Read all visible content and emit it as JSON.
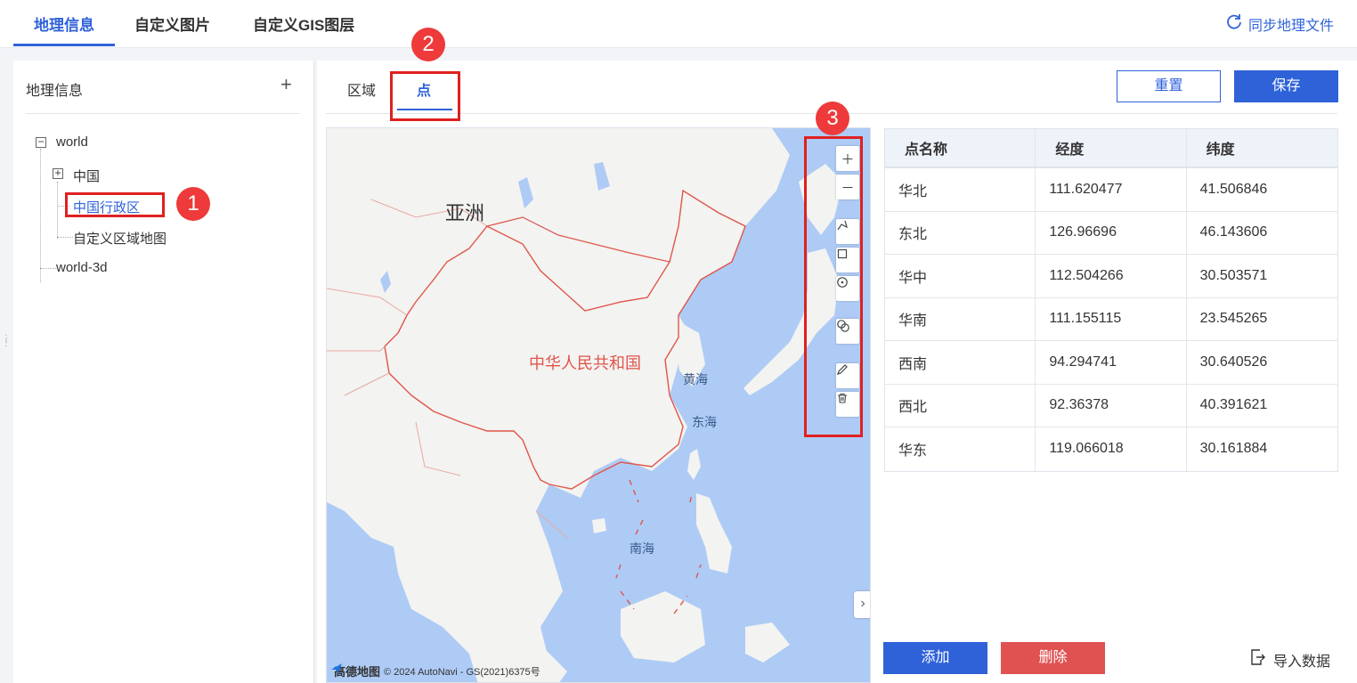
{
  "top_tabs": [
    {
      "label": "地理信息",
      "active": true
    },
    {
      "label": "自定义图片",
      "active": false
    },
    {
      "label": "自定义GIS图层",
      "active": false
    }
  ],
  "sync_label": "同步地理文件",
  "left_panel": {
    "title": "地理信息",
    "add_icon": "+",
    "tree": [
      {
        "label": "world",
        "expander": "−"
      },
      {
        "label": "中国",
        "expander": "+"
      },
      {
        "label": "中国行政区",
        "selected": true
      },
      {
        "label": "自定义区域地图"
      },
      {
        "label": "world-3d"
      }
    ]
  },
  "annotations": [
    "1",
    "2",
    "3"
  ],
  "sub_tabs": [
    {
      "label": "区域",
      "active": false
    },
    {
      "label": "点",
      "active": true
    }
  ],
  "buttons": {
    "reset": "重置",
    "save": "保存",
    "add": "添加",
    "delete": "删除",
    "import": "导入数据"
  },
  "map": {
    "labels": {
      "asia": "亚洲",
      "china": "中华人民共和国",
      "yellow_sea": "黄海",
      "east_sea": "东海",
      "south_sea": "南海"
    },
    "attribution_logo": "高德地图",
    "attribution_text": "© 2024 AutoNavi - GS(2021)6375号",
    "toolbar_icons": [
      "zoom-in-icon",
      "zoom-out-icon",
      "polyline-icon",
      "rectangle-icon",
      "circle-icon",
      "merge-icon",
      "edit-icon",
      "delete-icon"
    ],
    "colors": {
      "water": "#aecbf5",
      "land": "#f3f3f1",
      "border": "#e0544a"
    }
  },
  "table": {
    "headers": [
      "点名称",
      "经度",
      "纬度"
    ],
    "rows": [
      [
        "华北",
        "111.620477",
        "41.506846"
      ],
      [
        "东北",
        "126.96696",
        "46.143606"
      ],
      [
        "华中",
        "112.504266",
        "30.503571"
      ],
      [
        "华南",
        "111.155115",
        "23.545265"
      ],
      [
        "西南",
        "94.294741",
        "30.640526"
      ],
      [
        "西北",
        "92.36378",
        "40.391621"
      ],
      [
        "华东",
        "119.066018",
        "30.161884"
      ]
    ]
  },
  "colors": {
    "accent": "#2f62d9",
    "danger": "#e05252",
    "annotation": "#e02020"
  }
}
